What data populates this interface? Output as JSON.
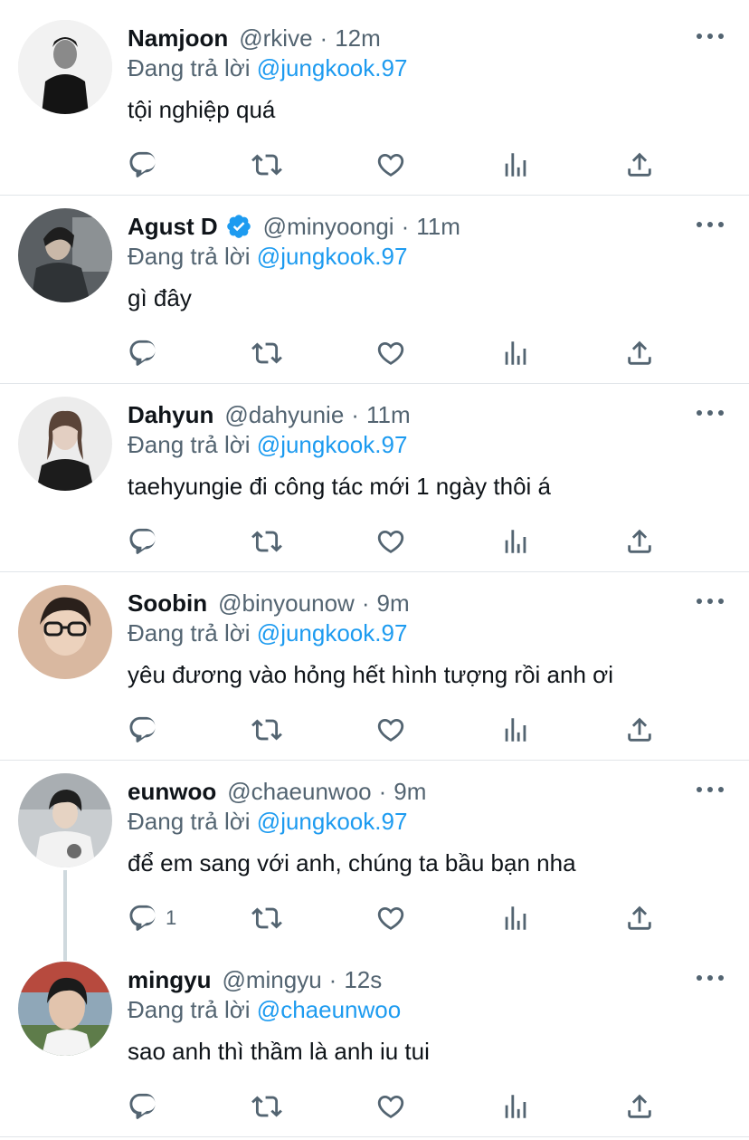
{
  "reply_prefix": "Đang trả lời",
  "colors": {
    "text_primary": "#0f1419",
    "text_secondary": "#536471",
    "link": "#1d9bf0",
    "divider": "#e1e5e9",
    "verified": "#1d9bf0"
  },
  "icons": {
    "more": "more-horizontal-icon",
    "reply": "reply-icon",
    "retweet": "retweet-icon",
    "like": "heart-icon",
    "stats": "analytics-icon",
    "share": "share-icon",
    "verified": "verified-badge-icon"
  },
  "tweets": [
    {
      "name": "Namjoon",
      "handle": "@rkive",
      "separator": "·",
      "time": "12m",
      "verified": false,
      "reply_to": "@jungkook.97",
      "text": "tội nghiệp quá",
      "reply_count": ""
    },
    {
      "name": "Agust D",
      "handle": "@minyoongi",
      "separator": "·",
      "time": "11m",
      "verified": true,
      "reply_to": "@jungkook.97",
      "text": "gì đây",
      "reply_count": ""
    },
    {
      "name": "Dahyun",
      "handle": "@dahyunie",
      "separator": "·",
      "time": "11m",
      "verified": false,
      "reply_to": "@jungkook.97",
      "text": "taehyungie đi công tác mới 1 ngày thôi á",
      "reply_count": ""
    },
    {
      "name": "Soobin",
      "handle": "@binyounow",
      "separator": "·",
      "time": "9m",
      "verified": false,
      "reply_to": "@jungkook.97",
      "text": "yêu đương vào hỏng hết hình tượng rồi anh ơi",
      "reply_count": ""
    },
    {
      "name": "eunwoo",
      "handle": "@chaeunwoo",
      "separator": "·",
      "time": "9m",
      "verified": false,
      "reply_to": "@jungkook.97",
      "text": "để em sang với anh, chúng ta bầu bạn nha",
      "reply_count": "1"
    },
    {
      "name": "mingyu",
      "handle": "@mingyu",
      "separator": "·",
      "time": "12s",
      "verified": false,
      "reply_to": "@chaeunwoo",
      "text": "sao anh thì thầm là anh iu tui",
      "reply_count": ""
    }
  ]
}
